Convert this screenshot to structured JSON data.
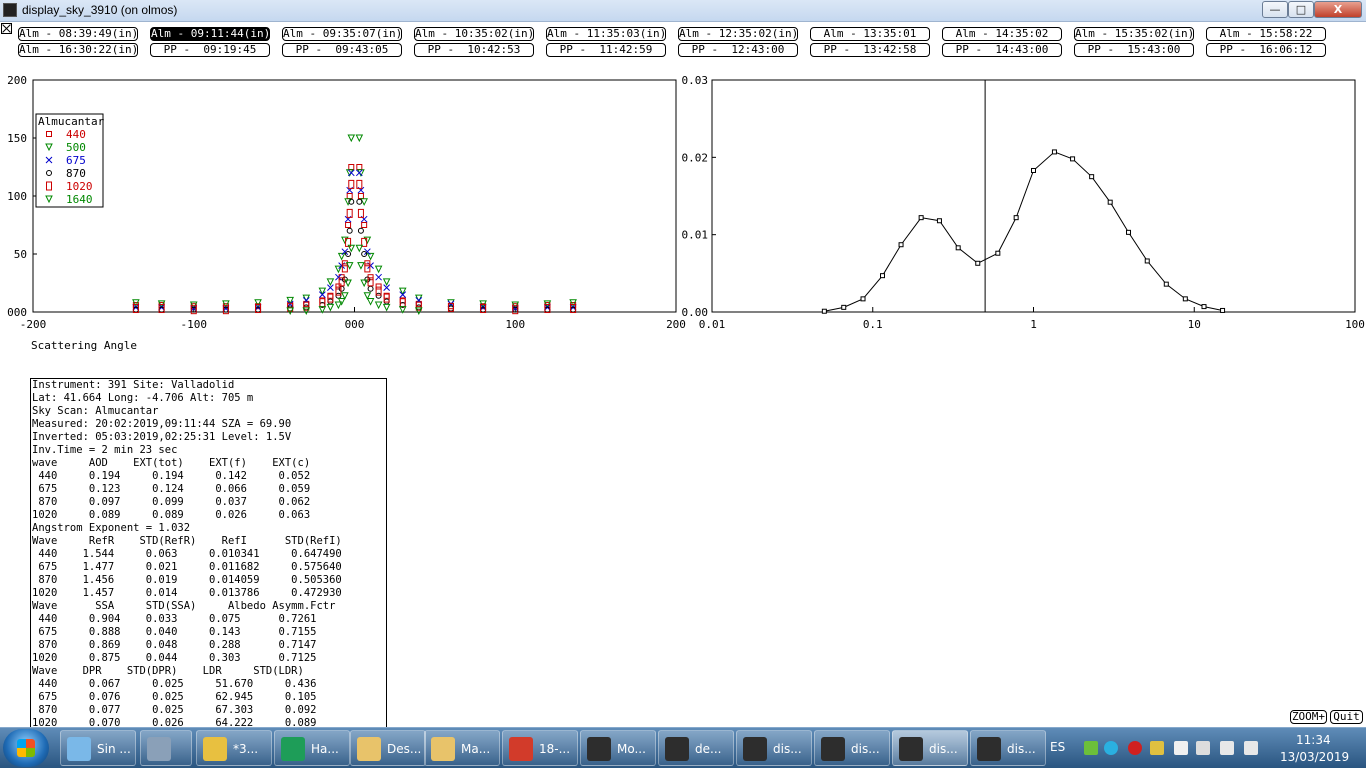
{
  "window": {
    "title": "display_sky_3910 (on olmos)",
    "minimize_label": "—",
    "maximize_label": "□",
    "close_label": "X"
  },
  "scans": [
    {
      "label": "Alm - 08:39:49(in)",
      "selected": false
    },
    {
      "label": "Alm - 09:11:44(in)",
      "selected": true
    },
    {
      "label": "Alm - 09:35:07(in)",
      "selected": false
    },
    {
      "label": "Alm - 10:35:02(in)",
      "selected": false
    },
    {
      "label": "Alm - 11:35:03(in)",
      "selected": false
    },
    {
      "label": "Alm - 12:35:02(in)",
      "selected": false
    },
    {
      "label": "Alm - 13:35:01",
      "selected": false
    },
    {
      "label": "Alm - 14:35:02",
      "selected": false
    },
    {
      "label": "Alm - 15:35:02(in)",
      "selected": false
    },
    {
      "label": "Alm - 15:58:22",
      "selected": false
    },
    {
      "label": "Alm - 16:30:22(in)",
      "selected": false
    },
    {
      "label": "PP -  09:19:45",
      "selected": false
    },
    {
      "label": "PP -  09:43:05",
      "selected": false
    },
    {
      "label": "PP -  10:42:53",
      "selected": false
    },
    {
      "label": "PP -  11:42:59",
      "selected": false
    },
    {
      "label": "PP -  12:43:00",
      "selected": false
    },
    {
      "label": "PP -  13:42:58",
      "selected": false
    },
    {
      "label": "PP -  14:43:00",
      "selected": false
    },
    {
      "label": "PP -  15:43:00",
      "selected": false
    },
    {
      "label": "PP -  16:06:12",
      "selected": false
    }
  ],
  "chart_data": [
    {
      "type": "scatter",
      "xlabel": "Scattering Angle",
      "xlim": [
        -200,
        200
      ],
      "ylim": [
        0,
        200
      ],
      "xticks": [
        "-200",
        "-100",
        "000",
        "100",
        "200"
      ],
      "yticks": [
        "000",
        "50",
        "100",
        "150",
        "200"
      ],
      "legend_title": "Almucantar",
      "legend_position": "top-left",
      "series": [
        {
          "name": "440",
          "color": "#cc0000",
          "marker": "square",
          "x": [
            -136,
            -120,
            -100,
            -80,
            -60,
            -40,
            -30,
            -20,
            -15,
            -10,
            -8,
            -6,
            -4,
            -3,
            -2,
            3,
            4,
            6,
            8,
            10,
            15,
            20,
            30,
            40,
            60,
            80,
            100,
            120,
            136
          ],
          "y": [
            6,
            6,
            5,
            5,
            5,
            6,
            7,
            10,
            14,
            22,
            30,
            42,
            75,
            100,
            125,
            125,
            100,
            75,
            42,
            30,
            22,
            14,
            10,
            7,
            5,
            5,
            5,
            6,
            6
          ]
        },
        {
          "name": "500",
          "color": "#008800",
          "marker": "triangle-down",
          "x": [
            -136,
            -120,
            -100,
            -80,
            -60,
            -40,
            -30,
            -20,
            -15,
            -10,
            -8,
            -6,
            -4,
            -3,
            -2,
            3,
            4,
            6,
            8,
            10,
            15,
            20,
            30,
            40,
            60,
            80,
            100,
            120,
            136
          ],
          "y": [
            8,
            7,
            6,
            7,
            8,
            10,
            12,
            18,
            26,
            37,
            48,
            62,
            95,
            120,
            150,
            150,
            120,
            95,
            62,
            48,
            37,
            26,
            18,
            12,
            8,
            7,
            6,
            7,
            8
          ]
        },
        {
          "name": "675",
          "color": "#0000cc",
          "marker": "x",
          "x": [
            -136,
            -120,
            -100,
            -80,
            -60,
            -40,
            -30,
            -20,
            -15,
            -10,
            -8,
            -6,
            -4,
            -3,
            -2,
            3,
            4,
            6,
            8,
            10,
            15,
            20,
            30,
            40,
            60,
            80,
            100,
            120,
            136
          ],
          "y": [
            4,
            4,
            3,
            3,
            4,
            7,
            10,
            15,
            21,
            30,
            40,
            52,
            80,
            105,
            120,
            120,
            105,
            80,
            52,
            40,
            30,
            21,
            15,
            10,
            7,
            4,
            3,
            4,
            4
          ]
        },
        {
          "name": "870",
          "color": "#000000",
          "marker": "circle",
          "x": [
            -136,
            -120,
            -100,
            -80,
            -60,
            -40,
            -30,
            -20,
            -15,
            -10,
            -8,
            -6,
            -4,
            -3,
            -2,
            3,
            4,
            6,
            8,
            10,
            15,
            20,
            30,
            40,
            60,
            80,
            100,
            120,
            136
          ],
          "y": [
            2,
            2,
            2,
            2,
            2,
            3,
            4,
            6,
            9,
            14,
            20,
            28,
            50,
            70,
            95,
            95,
            70,
            50,
            28,
            20,
            14,
            9,
            6,
            4,
            3,
            2,
            2,
            2,
            2
          ]
        },
        {
          "name": "1020",
          "color": "#cc0000",
          "marker": "rect-tall",
          "x": [
            -136,
            -120,
            -100,
            -80,
            -60,
            -40,
            -30,
            -20,
            -15,
            -10,
            -8,
            -6,
            -4,
            -3,
            -2,
            3,
            4,
            6,
            8,
            10,
            15,
            20,
            30,
            40,
            60,
            80,
            100,
            120,
            136
          ],
          "y": [
            3,
            3,
            2,
            2,
            3,
            4,
            5,
            8,
            12,
            18,
            26,
            38,
            60,
            85,
            110,
            110,
            85,
            60,
            38,
            26,
            18,
            12,
            8,
            5,
            4,
            3,
            2,
            3,
            3
          ]
        },
        {
          "name": "1640",
          "color": "#008800",
          "marker": "triangle-down",
          "x": [
            -40,
            -30,
            -20,
            -15,
            -10,
            -8,
            -6,
            -4,
            -3,
            -2,
            3,
            4,
            6,
            8,
            10,
            15,
            20,
            30,
            40
          ],
          "y": [
            1,
            1,
            2,
            4,
            6,
            9,
            14,
            25,
            40,
            55,
            55,
            40,
            25,
            14,
            9,
            6,
            4,
            2,
            1
          ]
        }
      ]
    },
    {
      "type": "line",
      "xscale": "log",
      "xlim": [
        0.01,
        100
      ],
      "ylim": [
        0,
        0.03
      ],
      "xticks": [
        "0.01",
        "0.1",
        "1",
        "10",
        "100"
      ],
      "yticks": [
        "0.00",
        "0.01",
        "0.02",
        "0.03"
      ],
      "vertical_line_x": 0.5,
      "series": [
        {
          "x": [
            0.05,
            0.066,
            0.087,
            0.115,
            0.15,
            0.2,
            0.26,
            0.34,
            0.45,
            0.6,
            0.78,
            1.0,
            1.35,
            1.75,
            2.3,
            3.0,
            3.9,
            5.1,
            6.7,
            8.8,
            11.5,
            15.0
          ],
          "y": [
            0.0001,
            0.0006,
            0.0017,
            0.0047,
            0.0087,
            0.0122,
            0.0118,
            0.0083,
            0.0063,
            0.0076,
            0.0122,
            0.0183,
            0.0207,
            0.0198,
            0.0175,
            0.0142,
            0.0103,
            0.0066,
            0.0036,
            0.0017,
            0.0007,
            0.0002
          ]
        }
      ]
    }
  ],
  "info_lines": [
    "Instrument: 391 Site: Valladolid",
    "Lat: 41.664 Long: -4.706 Alt: 705 m",
    "Sky Scan: Almucantar",
    "Measured: 20:02:2019,09:11:44 SZA = 69.90",
    "Inverted: 05:03:2019,02:25:31 Level: 1.5V",
    "Inv.Time = 2 min 23 sec",
    "wave     AOD    EXT(tot)    EXT(f)    EXT(c)",
    " 440     0.194     0.194     0.142     0.052",
    " 675     0.123     0.124     0.066     0.059",
    " 870     0.097     0.099     0.037     0.062",
    "1020     0.089     0.089     0.026     0.063",
    "Angstrom Exponent = 1.032",
    "Wave     RefR    STD(RefR)    RefI      STD(RefI)",
    " 440    1.544     0.063     0.010341     0.647490",
    " 675    1.477     0.021     0.011682     0.575640",
    " 870    1.456     0.019     0.014059     0.505360",
    "1020    1.457     0.014     0.013786     0.472930",
    "Wave      SSA     STD(SSA)     Albedo Asymm.Fctr",
    " 440     0.904    0.033     0.075      0.7261",
    " 675     0.888    0.040     0.143      0.7155",
    " 870     0.869    0.048     0.288      0.7147",
    "1020     0.875    0.044     0.303      0.7125",
    "Wave    DPR    STD(DPR)    LDR     STD(LDR)",
    " 440     0.067     0.025     51.670     0.436",
    " 675     0.076     0.025     62.945     0.105",
    " 870     0.077     0.025     67.303     0.092",
    "1020     0.070     0.026     64.222     0.089"
  ],
  "buttons": {
    "zoom": "ZOOM+",
    "quit": "Quit"
  },
  "taskbar": {
    "items": [
      {
        "label": "Sin ...",
        "icon": "sticky-notes-icon",
        "color": "#7ab8e8",
        "active": false
      },
      {
        "label": "",
        "icon": "calculator-icon",
        "color": "#8aa0b8",
        "active": false
      },
      {
        "label": "*3...",
        "icon": "chrome-icon",
        "color": "#e8c040",
        "active": false
      },
      {
        "label": "Ha...",
        "icon": "hangouts-icon",
        "color": "#1e9d58",
        "active": false
      },
      {
        "label": "Des...",
        "icon": "folder-icon",
        "color": "#e8c36a",
        "active": false
      },
      {
        "label": "Ma...",
        "icon": "folder-icon",
        "color": "#e8c36a",
        "active": false
      },
      {
        "label": "18-...",
        "icon": "pdf-icon",
        "color": "#d23b2a",
        "active": false
      },
      {
        "label": "Mo...",
        "icon": "terminal-icon",
        "color": "#2d2d2d",
        "active": false
      },
      {
        "label": "de...",
        "icon": "terminal-icon",
        "color": "#2d2d2d",
        "active": false
      },
      {
        "label": "dis...",
        "icon": "terminal-icon",
        "color": "#2d2d2d",
        "active": false
      },
      {
        "label": "dis...",
        "icon": "terminal-icon",
        "color": "#2d2d2d",
        "active": false
      },
      {
        "label": "dis...",
        "icon": "terminal-icon",
        "color": "#2d2d2d",
        "active": true
      },
      {
        "label": "dis...",
        "icon": "terminal-icon",
        "color": "#2d2d2d",
        "active": false
      }
    ],
    "language": "ES",
    "time": "11:34",
    "date": "13/03/2019"
  }
}
